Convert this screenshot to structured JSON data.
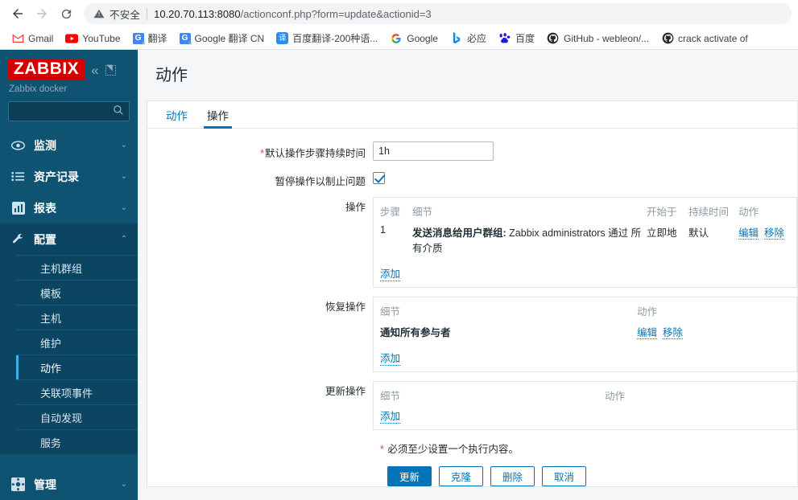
{
  "browser": {
    "nav": {
      "back": "back-arrow",
      "forward": "forward-arrow",
      "reload": "reload-icon"
    },
    "omnibox": {
      "security_label": "不安全",
      "url_host": "10.20.70.113:8080",
      "url_path": "/actionconf.php?form=update&actionid=3"
    },
    "bookmarks": [
      {
        "label": "Gmail",
        "icon": "gmail-icon"
      },
      {
        "label": "YouTube",
        "icon": "youtube-icon"
      },
      {
        "label": "翻译",
        "icon": "google-translate-icon"
      },
      {
        "label": "Google 翻译 CN",
        "icon": "google-translate-icon"
      },
      {
        "label": "百度翻译-200种语...",
        "icon": "baidu-fanyi-icon"
      },
      {
        "label": "Google",
        "icon": "google-icon"
      },
      {
        "label": "必应",
        "icon": "bing-icon"
      },
      {
        "label": "百度",
        "icon": "baidu-icon"
      },
      {
        "label": "GitHub - webleon/...",
        "icon": "github-icon"
      },
      {
        "label": "crack activate of",
        "icon": "github-icon"
      }
    ]
  },
  "sidebar": {
    "logo": "ZABBIX",
    "server_name": "Zabbix docker",
    "collapse_icon": "«",
    "search": {
      "value": "",
      "placeholder": ""
    },
    "menu": [
      {
        "label": "监测",
        "icon": "eye-icon",
        "chevron": "⌄",
        "expanded": false
      },
      {
        "label": "资产记录",
        "icon": "list-icon",
        "chevron": "⌄",
        "expanded": false
      },
      {
        "label": "报表",
        "icon": "chart-bar-icon",
        "chevron": "⌄",
        "expanded": false
      },
      {
        "label": "配置",
        "icon": "wrench-icon",
        "chevron": "⌃",
        "expanded": true
      }
    ],
    "submenu": [
      {
        "label": "主机群组",
        "active": false
      },
      {
        "label": "模板",
        "active": false
      },
      {
        "label": "主机",
        "active": false
      },
      {
        "label": "维护",
        "active": false
      },
      {
        "label": "动作",
        "active": true
      },
      {
        "label": "关联项事件",
        "active": false
      },
      {
        "label": "自动发现",
        "active": false
      },
      {
        "label": "服务",
        "active": false
      }
    ],
    "bottom_menu": {
      "label": "管理",
      "icon": "gear-icon",
      "chevron": "⌄"
    }
  },
  "page": {
    "title": "动作",
    "tabs": [
      {
        "label": "动作",
        "active": false
      },
      {
        "label": "操作",
        "active": true
      }
    ]
  },
  "form": {
    "default_duration": {
      "label": "默认操作步骤持续时间",
      "required": "*",
      "value": "1h"
    },
    "pause_suppressed": {
      "label": "暂停操作以制止问题",
      "checked": true
    },
    "operations": {
      "label": "操作",
      "headers": [
        "步骤",
        "细节",
        "开始于",
        "持续时间",
        "动作"
      ],
      "rows": [
        {
          "step": "1",
          "detail_bold": "发送消息给用户群组:",
          "detail_rest": "Zabbix administrators 通过 所有介质",
          "start": "立即地",
          "duration": "默认",
          "edit": "编辑",
          "remove": "移除"
        }
      ],
      "add_label": "添加"
    },
    "recovery_operations": {
      "label": "恢复操作",
      "headers": [
        "细节",
        "动作"
      ],
      "rows": [
        {
          "detail": "通知所有参与者",
          "edit": "编辑",
          "remove": "移除"
        }
      ],
      "add_label": "添加"
    },
    "update_operations": {
      "label": "更新操作",
      "headers": [
        "细节",
        "动作"
      ],
      "rows": [],
      "add_label": "添加"
    },
    "note": {
      "required": "*",
      "text": "必须至少设置一个执行内容。"
    },
    "buttons": [
      {
        "label": "更新",
        "style": "primary",
        "name": "update-button"
      },
      {
        "label": "克隆",
        "style": "secondary",
        "name": "clone-button"
      },
      {
        "label": "删除",
        "style": "secondary",
        "name": "delete-button"
      },
      {
        "label": "取消",
        "style": "secondary",
        "name": "cancel-button"
      }
    ]
  },
  "colors": {
    "brand_red": "#d40000",
    "sidebar_bg": "#0f5372",
    "accent_blue": "#0275b8",
    "required_red": "#d64f4f"
  }
}
